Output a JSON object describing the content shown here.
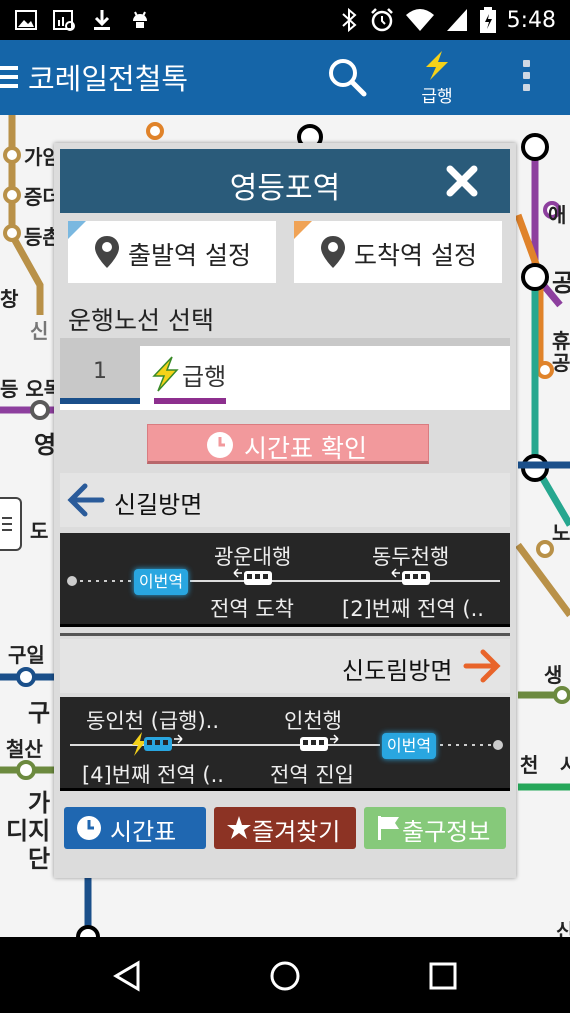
{
  "status_bar": {
    "time": "5:48",
    "icons": [
      "image-icon",
      "chart-search-icon",
      "download-icon",
      "android-icon",
      "bluetooth-icon",
      "alarm-icon",
      "wifi-icon",
      "signal-icon",
      "battery-icon"
    ]
  },
  "app_bar": {
    "title": "코레일전철톡",
    "express_label": "급행",
    "background": "#1565a8"
  },
  "map": {
    "labels": [
      {
        "text": "가암",
        "name": "map-label-1"
      },
      {
        "text": "증더",
        "name": "map-label-2"
      },
      {
        "text": "등촌",
        "name": "map-label-3"
      },
      {
        "text": "창",
        "name": "map-label-4"
      },
      {
        "text": "신",
        "name": "map-label-5"
      },
      {
        "text": "등 오목",
        "name": "map-label-6"
      },
      {
        "text": "영",
        "name": "map-label-7"
      },
      {
        "text": "도",
        "name": "map-label-8"
      },
      {
        "text": "구일",
        "name": "map-label-9"
      },
      {
        "text": "구",
        "name": "map-label-10"
      },
      {
        "text": "철산",
        "name": "map-label-11"
      },
      {
        "text": "가",
        "name": "map-label-12"
      },
      {
        "text": "디지",
        "name": "map-label-13"
      },
      {
        "text": "단",
        "name": "map-label-14"
      },
      {
        "text": "애",
        "name": "map-label-15"
      },
      {
        "text": "공",
        "name": "map-label-16"
      },
      {
        "text": "휴",
        "name": "map-label-17"
      },
      {
        "text": "공",
        "name": "map-label-18"
      },
      {
        "text": "노",
        "name": "map-label-19"
      },
      {
        "text": "생",
        "name": "map-label-20"
      },
      {
        "text": "천",
        "name": "map-label-21"
      },
      {
        "text": "시",
        "name": "map-label-22"
      },
      {
        "text": "신",
        "name": "map-label-23"
      }
    ]
  },
  "dialog": {
    "title": "영등포역",
    "departure_label": "출발역 설정",
    "arrival_label": "도착역 설정",
    "line_select_label": "운행노선 선택",
    "line_number": "1",
    "express_tab": "급행",
    "timetable_check_label": "시간표 확인",
    "direction_up": {
      "label": "신길방면",
      "current_badge": "이번역",
      "trains": [
        {
          "dest": "광운대행",
          "status": "전역 도착"
        },
        {
          "dest": "동두천행",
          "status": "[2]번째 전역 (.."
        }
      ]
    },
    "direction_down": {
      "label": "신도림방면",
      "current_badge": "이번역",
      "trains": [
        {
          "dest": "동인천 (급행)..",
          "status": "[4]번째 전역 (.."
        },
        {
          "dest": "인천행",
          "status": "전역 진입"
        }
      ]
    },
    "buttons": {
      "timetable": "시간표",
      "favorites": "즐겨찾기",
      "exit_info": "출구정보"
    }
  },
  "colors": {
    "header": "#2a5b7a",
    "line1": "#1a4f8a",
    "express": "#8d2f8e",
    "timetable_btn": "#1f67b1",
    "favorites_btn": "#8c3324",
    "exit_btn": "#86c97a"
  }
}
